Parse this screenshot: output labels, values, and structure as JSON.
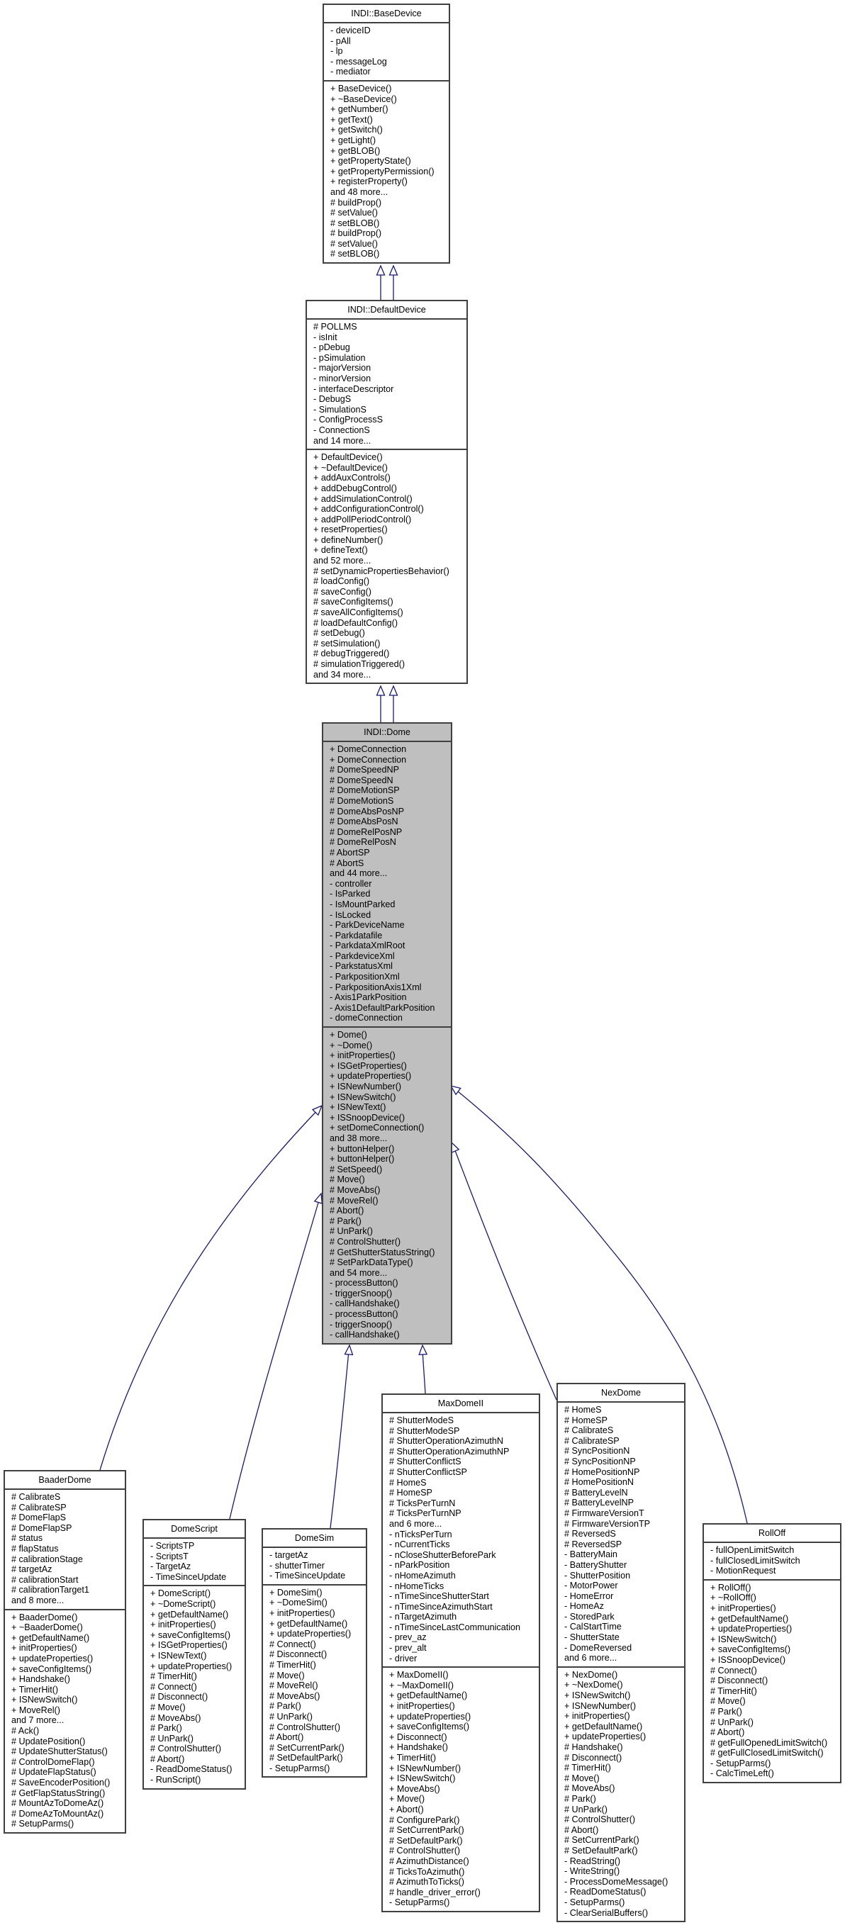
{
  "diagram": {
    "type": "class-inheritance",
    "edge_color": "#191970",
    "focus_fill": "#bfbfbf",
    "classes": [
      {
        "id": "basedevice",
        "name": "INDI::BaseDevice",
        "attributes": [
          "- deviceID",
          "- pAll",
          "- lp",
          "- messageLog",
          "- mediator"
        ],
        "methods": [
          "+ BaseDevice()",
          "+ ~BaseDevice()",
          "+ getNumber()",
          "+ getText()",
          "+ getSwitch()",
          "+ getLight()",
          "+ getBLOB()",
          "+ getPropertyState()",
          "+ getPropertyPermission()",
          "+ registerProperty()",
          "and 48 more...",
          "# buildProp()",
          "# setValue()",
          "# setBLOB()",
          "# buildProp()",
          "# setValue()",
          "# setBLOB()"
        ]
      },
      {
        "id": "defaultdevice",
        "name": "INDI::DefaultDevice",
        "attributes": [
          "# POLLMS",
          "- isInit",
          "- pDebug",
          "- pSimulation",
          "- majorVersion",
          "- minorVersion",
          "- interfaceDescriptor",
          "- DebugS",
          "- SimulationS",
          "- ConfigProcessS",
          "- ConnectionS",
          "and 14 more..."
        ],
        "methods": [
          "+ DefaultDevice()",
          "+ ~DefaultDevice()",
          "+ addAuxControls()",
          "+ addDebugControl()",
          "+ addSimulationControl()",
          "+ addConfigurationControl()",
          "+ addPollPeriodControl()",
          "+ resetProperties()",
          "+ defineNumber()",
          "+ defineText()",
          "and 52 more...",
          "# setDynamicPropertiesBehavior()",
          "# loadConfig()",
          "# saveConfig()",
          "# saveConfigItems()",
          "# saveAllConfigItems()",
          "# loadDefaultConfig()",
          "# setDebug()",
          "# setSimulation()",
          "# debugTriggered()",
          "# simulationTriggered()",
          "and 34 more..."
        ]
      },
      {
        "id": "dome",
        "name": "INDI::Dome",
        "focus": true,
        "attributes": [
          "+ DomeConnection",
          "+ DomeConnection",
          "# DomeSpeedNP",
          "# DomeSpeedN",
          "# DomeMotionSP",
          "# DomeMotionS",
          "# DomeAbsPosNP",
          "# DomeAbsPosN",
          "# DomeRelPosNP",
          "# DomeRelPosN",
          "# AbortSP",
          "# AbortS",
          "and 44 more...",
          "- controller",
          "- IsParked",
          "- IsMountParked",
          "- IsLocked",
          "- ParkDeviceName",
          "- Parkdatafile",
          "- ParkdataXmlRoot",
          "- ParkdeviceXml",
          "- ParkstatusXml",
          "- ParkpositionXml",
          "- ParkpositionAxis1Xml",
          "- Axis1ParkPosition",
          "- Axis1DefaultParkPosition",
          "- domeConnection"
        ],
        "methods": [
          "+ Dome()",
          "+ ~Dome()",
          "+ initProperties()",
          "+ ISGetProperties()",
          "+ updateProperties()",
          "+ ISNewNumber()",
          "+ ISNewSwitch()",
          "+ ISNewText()",
          "+ ISSnoopDevice()",
          "+ setDomeConnection()",
          "and 38 more...",
          "+ buttonHelper()",
          "+ buttonHelper()",
          "# SetSpeed()",
          "# Move()",
          "# MoveAbs()",
          "# MoveRel()",
          "# Abort()",
          "# Park()",
          "# UnPark()",
          "# ControlShutter()",
          "# GetShutterStatusString()",
          "# SetParkDataType()",
          "and 54 more...",
          "- processButton()",
          "- triggerSnoop()",
          "- callHandshake()",
          "- processButton()",
          "- triggerSnoop()",
          "- callHandshake()"
        ]
      },
      {
        "id": "baaderdome",
        "name": "BaaderDome",
        "attributes": [
          "# CalibrateS",
          "# CalibrateSP",
          "# DomeFlapS",
          "# DomeFlapSP",
          "# status",
          "# flapStatus",
          "# calibrationStage",
          "# targetAz",
          "# calibrationStart",
          "# calibrationTarget1",
          "and 8 more..."
        ],
        "methods": [
          "+ BaaderDome()",
          "+ ~BaaderDome()",
          "+ getDefaultName()",
          "+ initProperties()",
          "+ updateProperties()",
          "+ saveConfigItems()",
          "+ Handshake()",
          "+ TimerHit()",
          "+ ISNewSwitch()",
          "+ MoveRel()",
          "and 7 more...",
          "# Ack()",
          "# UpdatePosition()",
          "# UpdateShutterStatus()",
          "# ControlDomeFlap()",
          "# UpdateFlapStatus()",
          "# SaveEncoderPosition()",
          "# GetFlapStatusString()",
          "# MountAzToDomeAz()",
          "# DomeAzToMountAz()",
          "# SetupParms()"
        ]
      },
      {
        "id": "domescript",
        "name": "DomeScript",
        "attributes": [
          "- ScriptsTP",
          "- ScriptsT",
          "- TargetAz",
          "- TimeSinceUpdate"
        ],
        "methods": [
          "+ DomeScript()",
          "+ ~DomeScript()",
          "+ getDefaultName()",
          "+ initProperties()",
          "+ saveConfigItems()",
          "+ ISGetProperties()",
          "+ ISNewText()",
          "+ updateProperties()",
          "# TimerHit()",
          "# Connect()",
          "# Disconnect()",
          "# Move()",
          "# MoveAbs()",
          "# Park()",
          "# UnPark()",
          "# ControlShutter()",
          "# Abort()",
          "- ReadDomeStatus()",
          "- RunScript()"
        ]
      },
      {
        "id": "domesim",
        "name": "DomeSim",
        "attributes": [
          "- targetAz",
          "- shutterTimer",
          "- TimeSinceUpdate"
        ],
        "methods": [
          "+ DomeSim()",
          "+ ~DomeSim()",
          "+ initProperties()",
          "+ getDefaultName()",
          "+ updateProperties()",
          "# Connect()",
          "# Disconnect()",
          "# TimerHit()",
          "# Move()",
          "# MoveRel()",
          "# MoveAbs()",
          "# Park()",
          "# UnPark()",
          "# ControlShutter()",
          "# Abort()",
          "# SetCurrentPark()",
          "# SetDefaultPark()",
          "- SetupParms()"
        ]
      },
      {
        "id": "maxdomeii",
        "name": "MaxDomeII",
        "attributes": [
          "# ShutterModeS",
          "# ShutterModeSP",
          "# ShutterOperationAzimuthN",
          "# ShutterOperationAzimuthNP",
          "# ShutterConflictS",
          "# ShutterConflictSP",
          "# HomeS",
          "# HomeSP",
          "# TicksPerTurnN",
          "# TicksPerTurnNP",
          "and 6 more...",
          "- nTicksPerTurn",
          "- nCurrentTicks",
          "- nCloseShutterBeforePark",
          "- nParkPosition",
          "- nHomeAzimuth",
          "- nHomeTicks",
          "- nTimeSinceShutterStart",
          "- nTimeSinceAzimuthStart",
          "- nTargetAzimuth",
          "- nTimeSinceLastCommunication",
          "- prev_az",
          "- prev_alt",
          "- driver"
        ],
        "methods": [
          "+ MaxDomeII()",
          "+ ~MaxDomeII()",
          "+ getDefaultName()",
          "+ initProperties()",
          "+ updateProperties()",
          "+ saveConfigItems()",
          "+ Disconnect()",
          "+ Handshake()",
          "+ TimerHit()",
          "+ ISNewNumber()",
          "+ ISNewSwitch()",
          "+ MoveAbs()",
          "+ Move()",
          "+ Abort()",
          "# ConfigurePark()",
          "# SetCurrentPark()",
          "# SetDefaultPark()",
          "# ControlShutter()",
          "# AzimuthDistance()",
          "# TicksToAzimuth()",
          "# AzimuthToTicks()",
          "# handle_driver_error()",
          "- SetupParms()"
        ]
      },
      {
        "id": "nexdome",
        "name": "NexDome",
        "attributes": [
          "# HomeS",
          "# HomeSP",
          "# CalibrateS",
          "# CalibrateSP",
          "# SyncPositionN",
          "# SyncPositionNP",
          "# HomePositionNP",
          "# HomePositionN",
          "# BatteryLevelN",
          "# BatteryLevelNP",
          "# FirmwareVersionT",
          "# FirmwareVersionTP",
          "# ReversedS",
          "# ReversedSP",
          "- BatteryMain",
          "- BatteryShutter",
          "- ShutterPosition",
          "- MotorPower",
          "- HomeError",
          "- HomeAz",
          "- StoredPark",
          "- CalStartTime",
          "- ShutterState",
          "- DomeReversed",
          "and 6 more..."
        ],
        "methods": [
          "+ NexDome()",
          "+ ~NexDome()",
          "+ ISNewSwitch()",
          "+ ISNewNumber()",
          "+ initProperties()",
          "+ getDefaultName()",
          "+ updateProperties()",
          "# Handshake()",
          "# Disconnect()",
          "# TimerHit()",
          "# Move()",
          "# MoveAbs()",
          "# Park()",
          "# UnPark()",
          "# ControlShutter()",
          "# Abort()",
          "# SetCurrentPark()",
          "# SetDefaultPark()",
          "- ReadString()",
          "- WriteString()",
          "- ProcessDomeMessage()",
          "- ReadDomeStatus()",
          "- SetupParms()",
          "- ClearSerialBuffers()"
        ]
      },
      {
        "id": "rolloff",
        "name": "RollOff",
        "attributes": [
          "- fullOpenLimitSwitch",
          "- fullClosedLimitSwitch",
          "- MotionRequest"
        ],
        "methods": [
          "+ RollOff()",
          "+ ~RollOff()",
          "+ initProperties()",
          "+ getDefaultName()",
          "+ updateProperties()",
          "+ ISNewSwitch()",
          "+ saveConfigItems()",
          "+ ISSnoopDevice()",
          "# Connect()",
          "# Disconnect()",
          "# TimerHit()",
          "# Move()",
          "# Park()",
          "# UnPark()",
          "# Abort()",
          "# getFullOpenedLimitSwitch()",
          "# getFullClosedLimitSwitch()",
          "- SetupParms()",
          "- CalcTimeLeft()"
        ]
      }
    ],
    "inheritance": [
      {
        "child": "defaultdevice",
        "parent": "basedevice"
      },
      {
        "child": "defaultdevice",
        "parent": "basedevice"
      },
      {
        "child": "dome",
        "parent": "defaultdevice"
      },
      {
        "child": "dome",
        "parent": "defaultdevice"
      },
      {
        "child": "baaderdome",
        "parent": "dome"
      },
      {
        "child": "domescript",
        "parent": "dome"
      },
      {
        "child": "domesim",
        "parent": "dome"
      },
      {
        "child": "maxdomeii",
        "parent": "dome"
      },
      {
        "child": "nexdome",
        "parent": "dome"
      },
      {
        "child": "rolloff",
        "parent": "dome"
      }
    ]
  }
}
